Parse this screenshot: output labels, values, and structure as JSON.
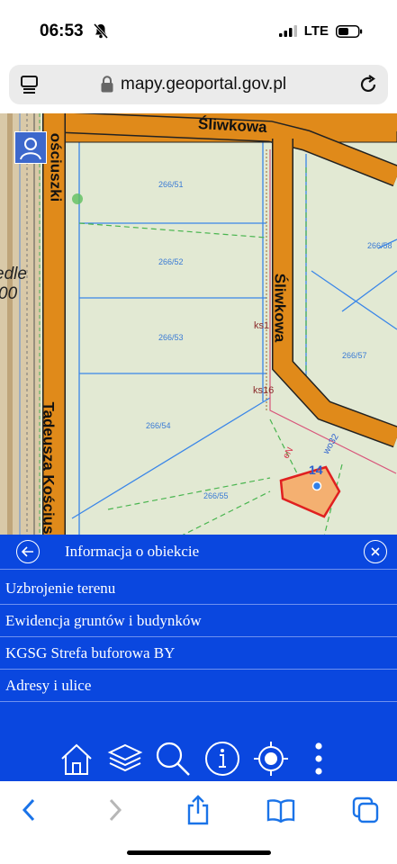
{
  "status": {
    "time": "06:53",
    "network": "LTE"
  },
  "browser": {
    "url": "mapy.geoportal.gov.pl"
  },
  "map": {
    "streets": {
      "top": "Śliwkowa",
      "right_vertical": "Śliwkowa",
      "left_vertical": "Tadeusza Kościus",
      "top_left_vertical": "ościuszki",
      "left_fragment_1": "edle",
      "left_fragment_2": "00"
    },
    "parcels": [
      "266/51",
      "266/52",
      "266/53",
      "266/54",
      "266/55",
      "266/57",
      "266/58"
    ],
    "labels": {
      "ks1": "ks1",
      "ks16": "ks16",
      "building_number": "14",
      "wo_label": "wo32",
      "en_label": "eN"
    }
  },
  "info_panel": {
    "title": "Informacja o obiekcie",
    "items": [
      {
        "label": "Uzbrojenie terenu"
      },
      {
        "label": "Ewidencja gruntów i budynków"
      },
      {
        "label": "KGSG Strefa buforowa BY"
      },
      {
        "label": "Adresy i ulice"
      }
    ]
  },
  "toolbar": {
    "icons": [
      "home-icon",
      "layers-icon",
      "search-icon",
      "info-icon",
      "locate-icon",
      "more-icon"
    ]
  },
  "colors": {
    "panel_blue": "#0a47df",
    "road_orange": "#e08a1a",
    "map_bg": "#dfe6cf"
  }
}
